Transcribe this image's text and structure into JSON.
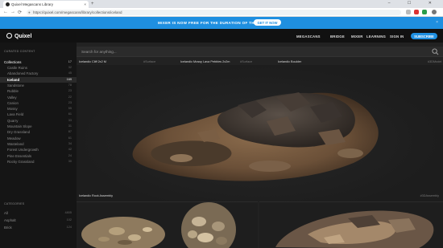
{
  "browser": {
    "tab_title": "Quixel Megascans Library",
    "new_tab": "+",
    "tab_close": "×",
    "window_controls": "– ☐ ✕",
    "back": "←",
    "forward": "→",
    "reload": "⟳",
    "lock": "🔒",
    "url": "https://quixel.com/megascans/library/collections/iceland"
  },
  "banner": {
    "text": "MIXER IS NOW FREE FOR THE DURATION OF THE BETA.",
    "button": "GET IT NOW",
    "close": "×"
  },
  "header": {
    "logo": "Quixel",
    "nav": [
      "MEGASCANS",
      "BRIDGE",
      "MIXER",
      "LEARNING",
      "SIGN IN"
    ],
    "subscribe": "SUBSCRIBE"
  },
  "sidebar": {
    "section1": "CURATED CONTENT",
    "top_item": {
      "label": "Collections",
      "count": "17"
    },
    "items": [
      {
        "label": "Castle Ruins",
        "count": "32"
      },
      {
        "label": "Abandoned Factory",
        "count": "45"
      },
      {
        "label": "Iceland",
        "count": "169",
        "active": true
      },
      {
        "label": "Sandstone",
        "count": "78"
      },
      {
        "label": "Rubble",
        "count": "23"
      },
      {
        "label": "Valley",
        "count": "22"
      },
      {
        "label": "Canion",
        "count": "23"
      },
      {
        "label": "Mossy",
        "count": "55"
      },
      {
        "label": "Lava Field",
        "count": "61"
      },
      {
        "label": "Quarry",
        "count": "33"
      },
      {
        "label": "Mountain Slope",
        "count": "31"
      },
      {
        "label": "Dry Grassland",
        "count": "87"
      },
      {
        "label": "Meadow",
        "count": "61"
      },
      {
        "label": "Wasteland",
        "count": "34"
      },
      {
        "label": "Forest Undergrowth",
        "count": "42"
      },
      {
        "label": "Pine Essentials",
        "count": "24"
      },
      {
        "label": "Rocky Grassland",
        "count": "30"
      }
    ],
    "section2": "CATEGORIES",
    "cat_items": [
      {
        "label": "All",
        "count": "4805"
      },
      {
        "label": "Asphalt",
        "count": "102"
      },
      {
        "label": "Brick",
        "count": "124"
      }
    ]
  },
  "main": {
    "search_placeholder": "Search for anything...",
    "labels": [
      {
        "title": "Icelandic Cliff 2x2 M",
        "sub": "#Surface"
      },
      {
        "title": "Icelandic Mossy Lava Pebbles 2x2m",
        "sub": "#Surface"
      },
      {
        "title": "Icelandic Boulder",
        "sub": ""
      },
      {
        "title": "#3DModel",
        "sub": ""
      }
    ],
    "hero_label": "Icelandic Rock Assembly",
    "hero_tag": "#3DAssembly"
  },
  "colors": {
    "accent": "#1f8fe0",
    "background": "#1c1c1c",
    "sidebar": "#151515"
  }
}
